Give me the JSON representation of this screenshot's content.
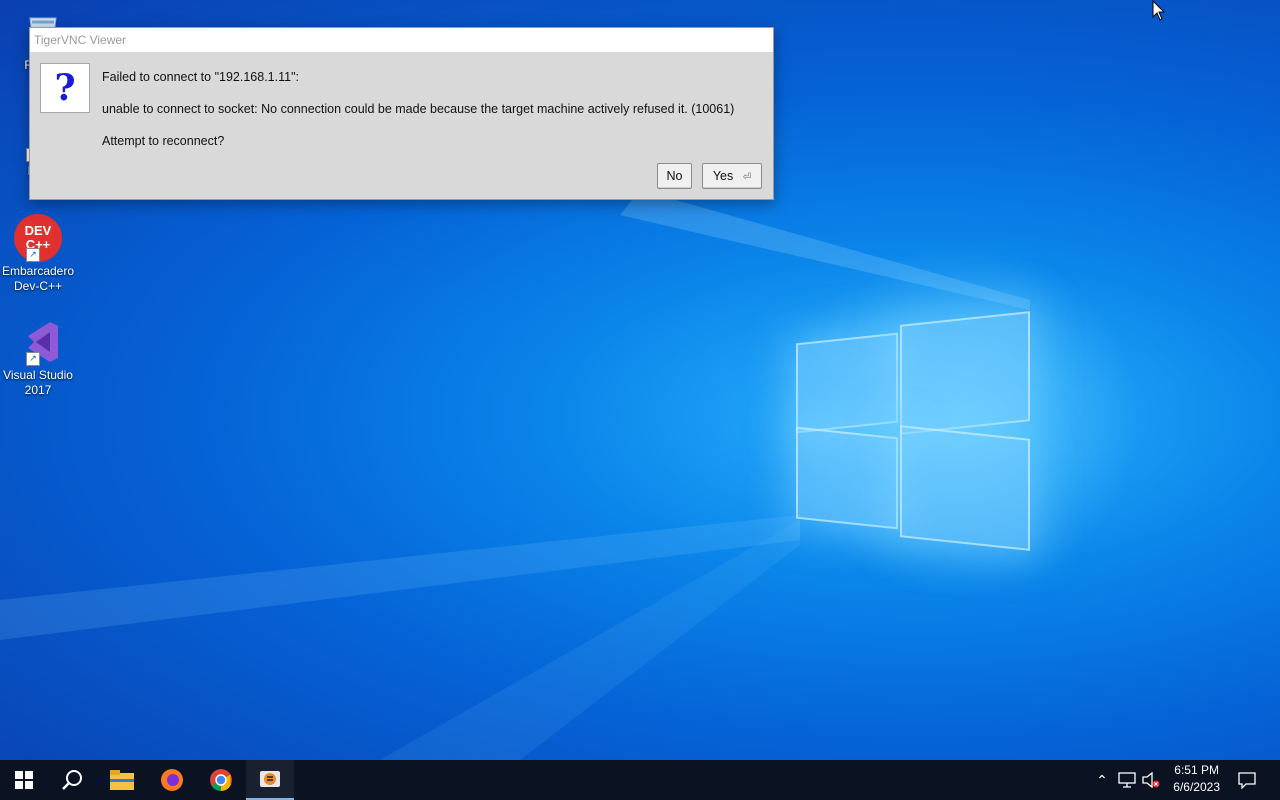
{
  "desktop": {
    "icons": [
      {
        "label": "Recy",
        "name": "recycle-bin"
      },
      {
        "label": "Eve",
        "name": "everything"
      },
      {
        "label": "Embarcadero Dev-C++",
        "name": "dev-cpp",
        "logo": "DEV C++"
      },
      {
        "label": "Visual Studio 2017",
        "name": "visual-studio"
      }
    ]
  },
  "dialog": {
    "title": "TigerVNC Viewer",
    "icon": "question-icon",
    "icon_glyph": "?",
    "line1": "Failed to connect to \"192.168.1.11\":",
    "line2": "unable to connect to socket: No connection could be made because the target machine actively refused it. (10061)",
    "line3": "Attempt to reconnect?",
    "no_label": "No",
    "yes_label": "Yes"
  },
  "taskbar": {
    "apps": [
      "start-icon",
      "search-icon",
      "file-explorer-icon",
      "firefox-icon",
      "chrome-icon",
      "tigervnc-icon"
    ],
    "active_app": "tigervnc-icon",
    "time": "6:51 PM",
    "date": "6/6/2023"
  },
  "colors": {
    "desktop_blue": "#0a7ee6",
    "taskbar": "#0b1322",
    "dialog_bg": "#d9d9d9"
  }
}
